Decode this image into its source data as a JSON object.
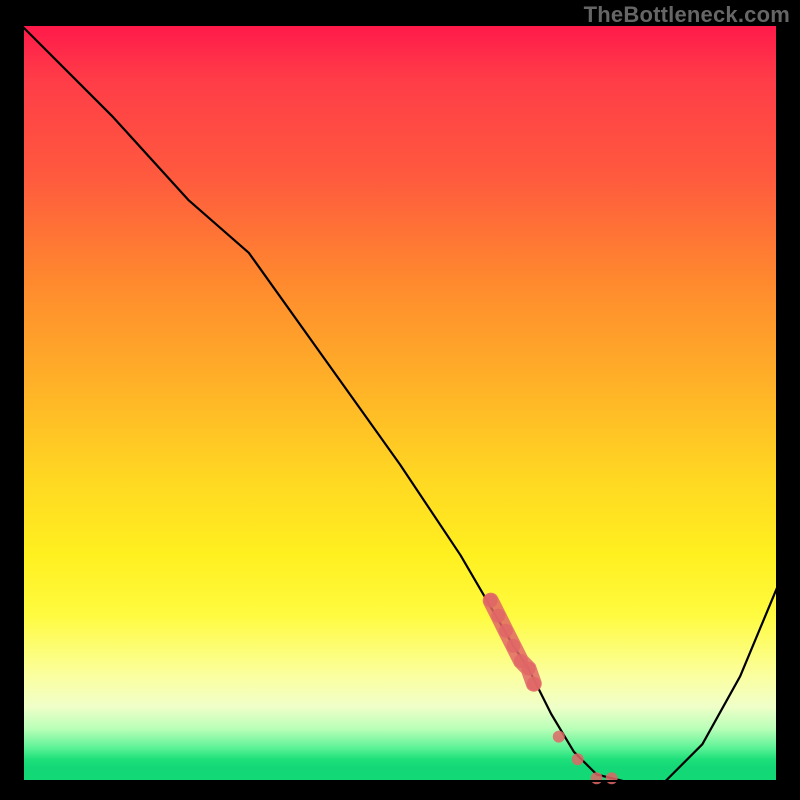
{
  "watermark": "TheBottleneck.com",
  "chart_data": {
    "type": "line",
    "title": "",
    "xlabel": "",
    "ylabel": "",
    "xlim": [
      0,
      100
    ],
    "ylim": [
      0,
      100
    ],
    "grid": false,
    "series": [
      {
        "name": "bottleneck-curve",
        "color": "#000000",
        "x": [
          0,
          12,
          22,
          30,
          40,
          50,
          58,
          65,
          67,
          70,
          73,
          76,
          80,
          85,
          90,
          95,
          100
        ],
        "values": [
          100,
          88,
          77,
          70,
          56,
          42,
          30,
          18,
          15,
          9,
          4,
          1,
          0,
          0,
          5,
          14,
          26
        ]
      }
    ],
    "highlight": {
      "name": "critical-segment",
      "color": "#e06666",
      "x": [
        62,
        63,
        64,
        65,
        66,
        67,
        67.7,
        71,
        73.5,
        76,
        78
      ],
      "values": [
        24,
        22,
        20,
        18,
        16,
        15,
        13,
        6,
        3,
        0.5,
        0.5
      ],
      "style": "dotted-thick"
    }
  },
  "colors": {
    "top": "#ff1a4a",
    "mid": "#ffd822",
    "bottom": "#12d876",
    "curve": "#000000",
    "highlight": "#e06666",
    "watermark": "#666666",
    "frame": "#000000"
  }
}
